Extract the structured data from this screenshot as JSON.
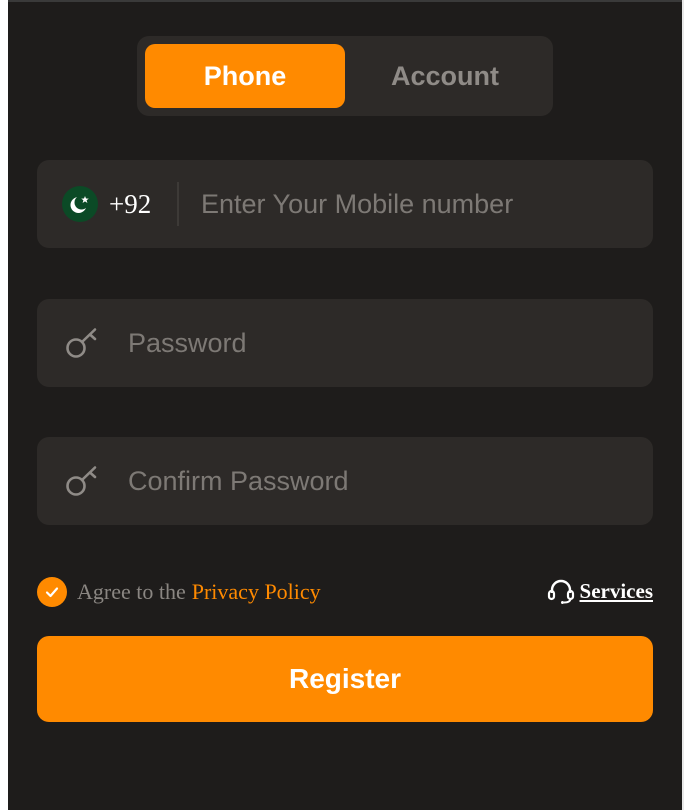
{
  "tabs": {
    "phone_label": "Phone",
    "account_label": "Account",
    "active": "phone"
  },
  "phone_field": {
    "country_code": "+92",
    "flag_icon": "pakistan-flag-icon",
    "placeholder": "Enter Your Mobile number",
    "value": ""
  },
  "password_field": {
    "icon": "key-icon",
    "placeholder": "Password",
    "value": ""
  },
  "confirm_field": {
    "icon": "key-icon",
    "placeholder": "Confirm Password",
    "value": ""
  },
  "agreement": {
    "checked": true,
    "prefix": "Agree to the",
    "link_label": "Privacy Policy"
  },
  "services": {
    "icon": "headset-icon",
    "label": "Services"
  },
  "register_label": "Register",
  "colors": {
    "accent": "#ff8a00",
    "background": "#1e1c1b",
    "field": "#2d2a28",
    "placeholder": "#7d7975"
  }
}
